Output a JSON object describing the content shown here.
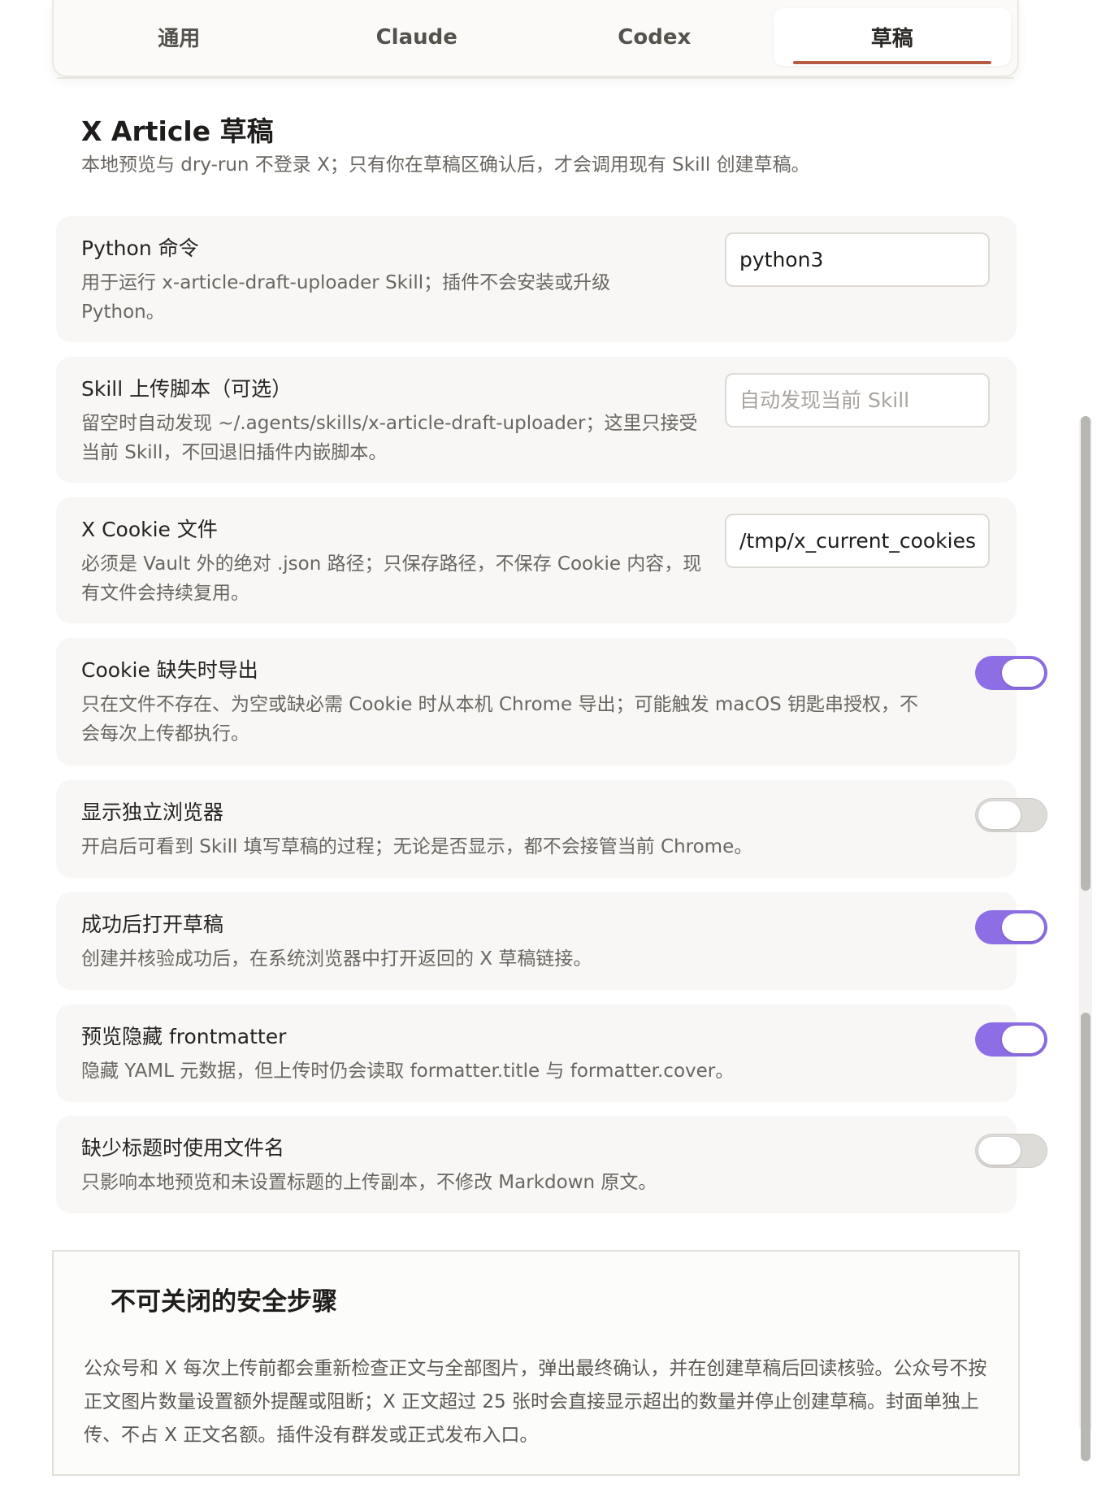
{
  "tabs": [
    {
      "label": "通用",
      "active": false
    },
    {
      "label": "Claude",
      "active": false
    },
    {
      "label": "Codex",
      "active": false
    },
    {
      "label": "草稿",
      "active": true
    }
  ],
  "section": {
    "title": "X Article 草稿",
    "description": "本地预览与 dry-run 不登录 X；只有你在草稿区确认后，才会调用现有 Skill 创建草稿。"
  },
  "settings": {
    "python_command": {
      "name": "Python 命令",
      "description": "用于运行 x-article-draft-uploader Skill；插件不会安装或升级 Python。",
      "value": "python3"
    },
    "skill_script": {
      "name": "Skill 上传脚本（可选）",
      "description": "留空时自动发现 ~/.agents/skills/x-article-draft-uploader；这里只接受当前 Skill，不回退旧插件内嵌脚本。",
      "value": "",
      "placeholder": "自动发现当前 Skill"
    },
    "cookie_file": {
      "name": "X Cookie 文件",
      "description": "必须是 Vault 外的绝对 .json 路径；只保存路径，不保存 Cookie 内容，现有文件会持续复用。",
      "value": "/tmp/x_current_cookies."
    },
    "cookie_export": {
      "name": "Cookie 缺失时导出",
      "description": "只在文件不存在、为空或缺必需 Cookie 时从本机 Chrome 导出；可能触发 macOS 钥匙串授权，不会每次上传都执行。",
      "enabled": true
    },
    "show_browser": {
      "name": "显示独立浏览器",
      "description": "开启后可看到 Skill 填写草稿的过程；无论是否显示，都不会接管当前 Chrome。",
      "enabled": false
    },
    "open_draft": {
      "name": "成功后打开草稿",
      "description": "创建并核验成功后，在系统浏览器中打开返回的 X 草稿链接。",
      "enabled": true
    },
    "hide_frontmatter": {
      "name": "预览隐藏 frontmatter",
      "description": "隐藏 YAML 元数据，但上传时仍会读取 formatter.title 与 formatter.cover。",
      "enabled": true
    },
    "filename_title": {
      "name": "缺少标题时使用文件名",
      "description": "只影响本地预览和未设置标题的上传副本，不修改 Markdown 原文。",
      "enabled": false
    }
  },
  "safety": {
    "title": "不可关闭的安全步骤",
    "text": "公众号和 X 每次上传前都会重新检查正文与全部图片，弹出最终确认，并在创建草稿后回读核验。公众号不按正文图片数量设置额外提醒或阻断；X 正文超过 25 张时会直接显示超出的数量并停止创建草稿。封面单独上传、不占 X 正文名额。插件没有群发或正式发布入口。"
  },
  "colors": {
    "accent_tab_underline": "#b85a44",
    "toggle_on": "#8e6ee4",
    "toggle_off": "#dedcd9"
  }
}
